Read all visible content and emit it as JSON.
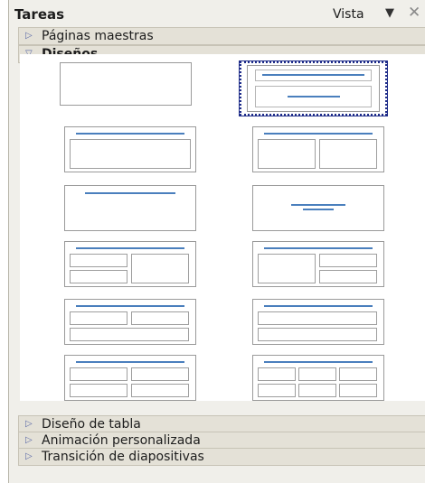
{
  "panel": {
    "title": "Tareas",
    "view_menu_label": "Vista",
    "view_menu_arrow": "▼",
    "close_glyph": "✕"
  },
  "sections": [
    {
      "label": "Páginas maestras",
      "expanded": false,
      "arrow": "▷"
    },
    {
      "label": "Diseños",
      "expanded": true,
      "arrow": "▽"
    },
    {
      "label": "Diseño de tabla",
      "expanded": false,
      "arrow": "▷"
    },
    {
      "label": "Animación personalizada",
      "expanded": false,
      "arrow": "▷"
    },
    {
      "label": "Transición de diapositivas",
      "expanded": false,
      "arrow": "▷"
    }
  ],
  "layouts": [
    {
      "kind": "blank",
      "selected": false
    },
    {
      "kind": "title-slide",
      "selected": true
    },
    {
      "kind": "title-content",
      "selected": false
    },
    {
      "kind": "title-two-content",
      "selected": false
    },
    {
      "kind": "title-only",
      "selected": false
    },
    {
      "kind": "centered-text",
      "selected": false
    },
    {
      "kind": "title-two-content-content",
      "selected": false
    },
    {
      "kind": "title-content-two-content",
      "selected": false
    },
    {
      "kind": "title-two-content-over-content",
      "selected": false
    },
    {
      "kind": "title-content-over-content",
      "selected": false
    },
    {
      "kind": "title-four-content",
      "selected": false
    },
    {
      "kind": "title-six-content",
      "selected": false
    }
  ],
  "colors": {
    "accent": "#4a7fbd",
    "selection": "#1f2d8a",
    "header_bg": "#e4e1d7",
    "panel_bg": "#f0efea"
  }
}
